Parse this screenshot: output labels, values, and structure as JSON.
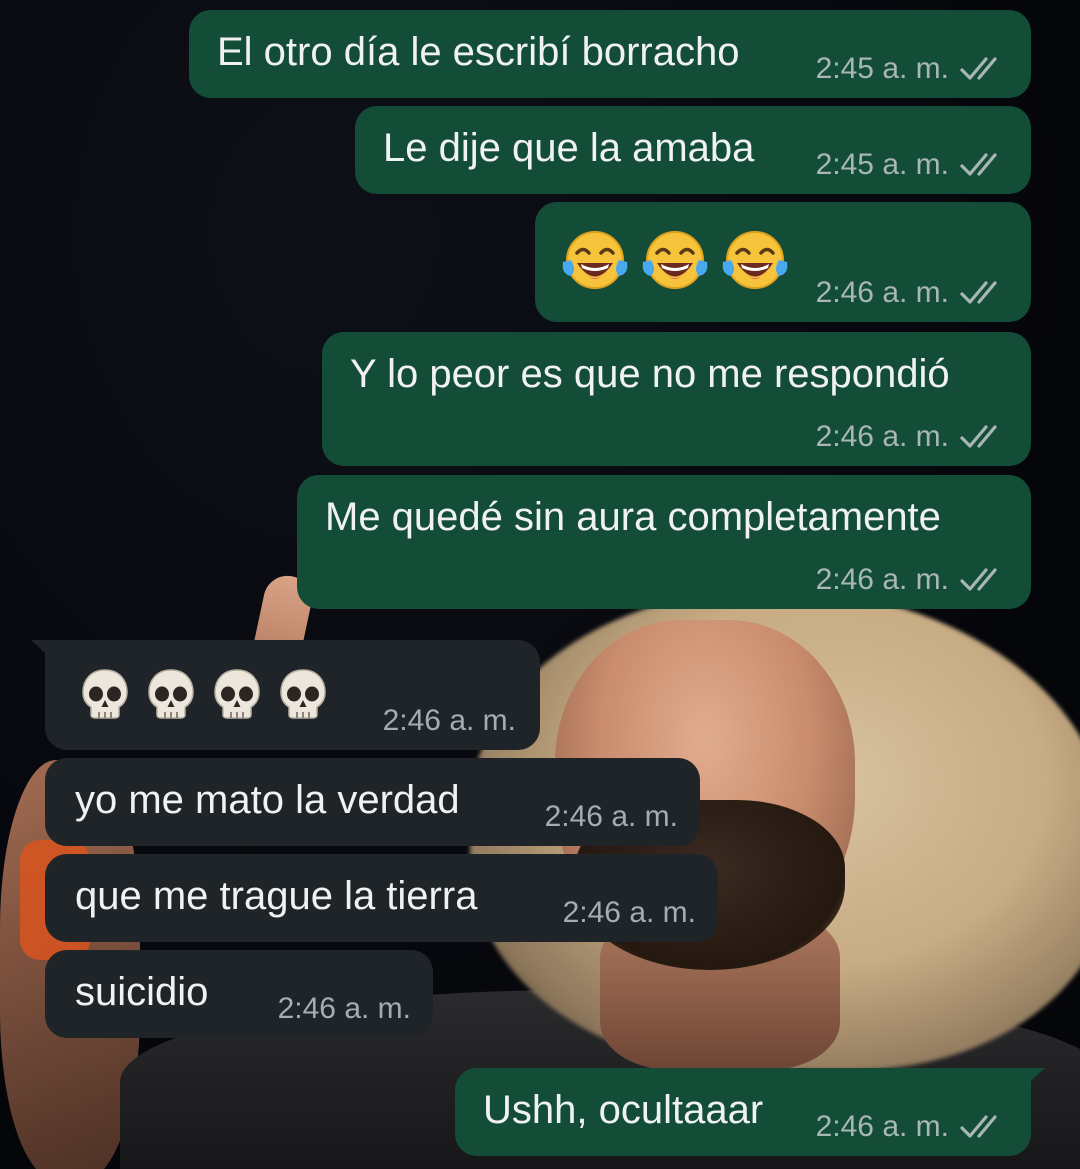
{
  "chat": {
    "messages": [
      {
        "direction": "out",
        "text": "El otro día le escribí borracho",
        "time": "2:45 a. m."
      },
      {
        "direction": "out",
        "text": "Le dije que la amaba",
        "time": "2:45 a. m."
      },
      {
        "direction": "out",
        "emoji": "face-with-tears-of-joy",
        "emoji_count": 3,
        "time": "2:46 a. m."
      },
      {
        "direction": "out",
        "text": "Y lo peor es que no me respondió",
        "time": "2:46 a. m."
      },
      {
        "direction": "out",
        "text": "Me quedé sin aura completamente",
        "time": "2:46 a. m."
      },
      {
        "direction": "in",
        "emoji": "skull",
        "emoji_count": 4,
        "time": "2:46 a. m."
      },
      {
        "direction": "in",
        "text": "yo me mato la verdad",
        "time": "2:46 a. m."
      },
      {
        "direction": "in",
        "text": "que me trague la tierra",
        "time": "2:46 a. m."
      },
      {
        "direction": "in",
        "text": "suicidio",
        "time": "2:46 a. m."
      },
      {
        "direction": "out",
        "text": "Ushh, ocultaaar",
        "time": "2:46 a. m."
      }
    ]
  },
  "icons": {
    "read_receipt": "double-check-icon",
    "laugh": "face-with-tears-of-joy-icon",
    "skull": "skull-icon"
  },
  "colors": {
    "outgoing_bubble": "#144d37",
    "incoming_bubble": "#1e2428",
    "message_text": "#f0f2f2",
    "meta_text": "#a8b7b2",
    "read_ticks": "#a8b7b2"
  }
}
